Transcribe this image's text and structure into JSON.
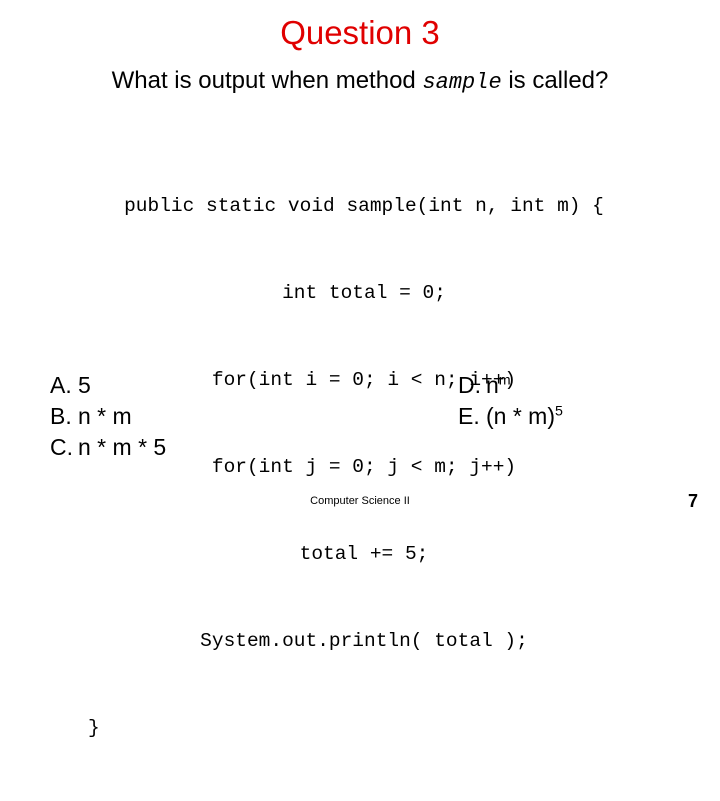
{
  "slide": {
    "title": "Question 3",
    "title_color": "#e00000",
    "question": {
      "prefix": "What is output when method ",
      "method_name": "sample",
      "suffix": " is called?"
    },
    "code": {
      "language": "java",
      "lines": [
        {
          "text": "public static void sample(int n, int m) {",
          "align": "center"
        },
        {
          "text": "int total = 0;",
          "align": "center"
        },
        {
          "text": "for(int i = 0; i < n; i++)",
          "align": "center"
        },
        {
          "text": "for(int j = 0; j < m; j++)",
          "align": "center"
        },
        {
          "text": "total += 5;",
          "align": "center"
        },
        {
          "text": "System.out.println( total );",
          "align": "center"
        },
        {
          "text": "}",
          "align": "left"
        }
      ]
    },
    "answers_left": [
      {
        "marker": "A.",
        "text": "5",
        "sup": ""
      },
      {
        "marker": "B.",
        "text": "n * m",
        "sup": ""
      },
      {
        "marker": "C.",
        "text": "n * m * 5",
        "sup": ""
      }
    ],
    "answers_right": [
      {
        "marker": "D.",
        "text": "n",
        "sup": "m"
      },
      {
        "marker": "E.",
        "text": "(n * m)",
        "sup": "5"
      }
    ],
    "footer": "Computer Science II",
    "page_number": "7"
  }
}
